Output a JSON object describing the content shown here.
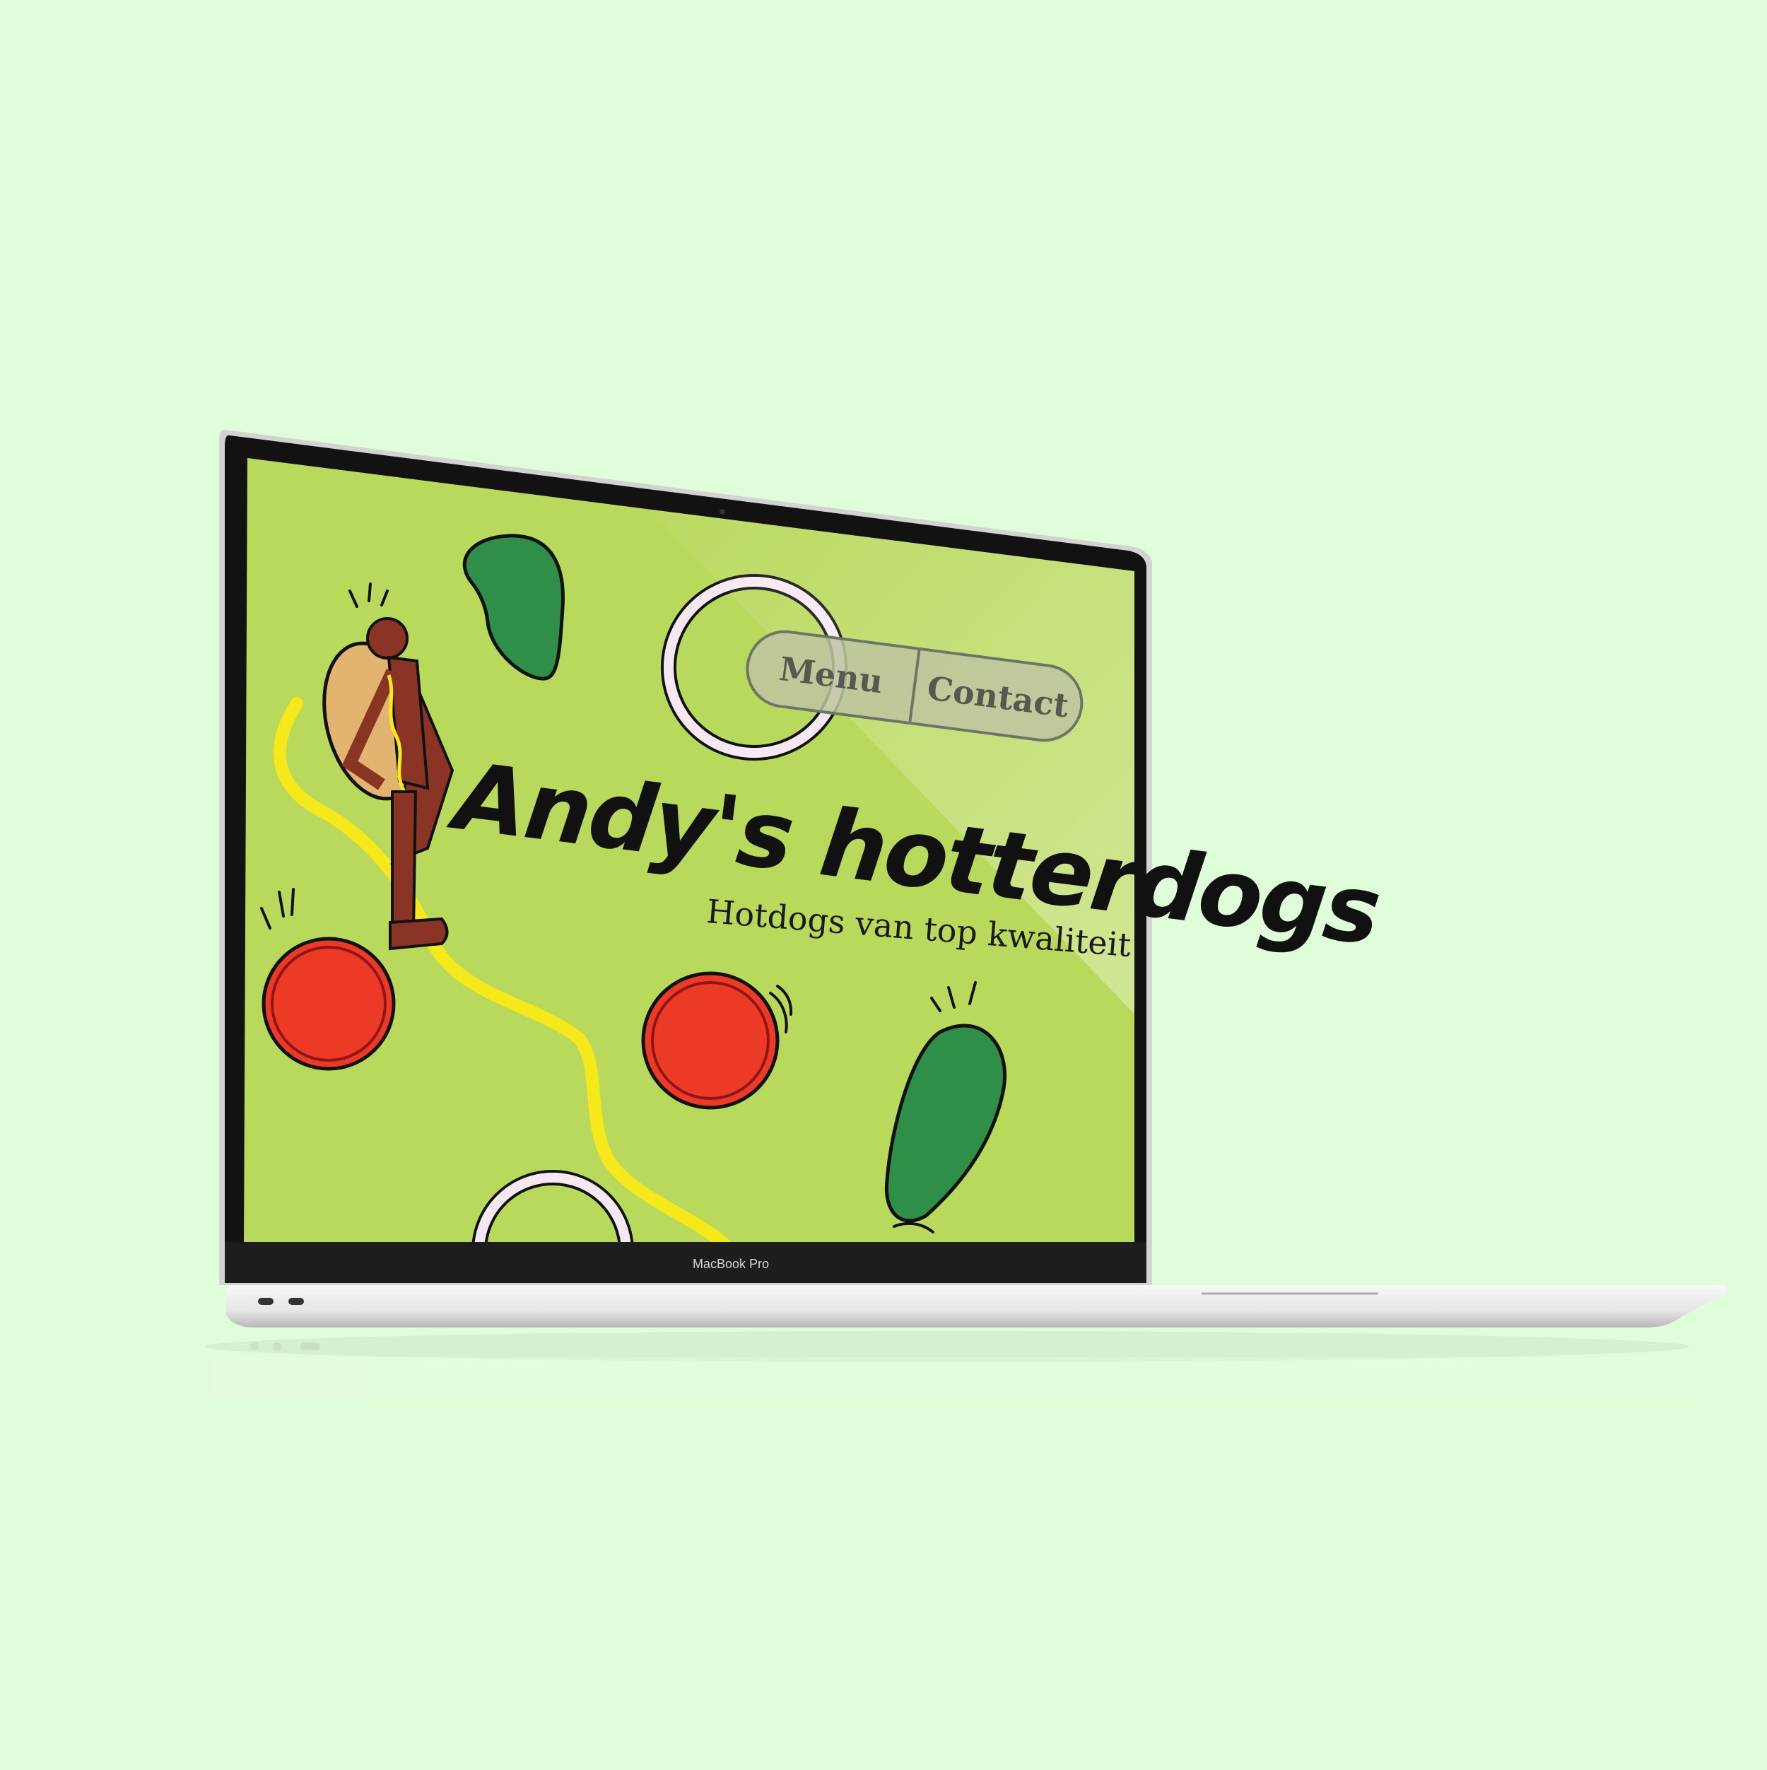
{
  "site": {
    "title": "Andy's hotterdogs",
    "tagline": "Hotdogs van top kwaliteit",
    "nav": [
      "Menu",
      "Contact"
    ],
    "colors": {
      "background": "#b9d95c",
      "pickle": "#2f8f49",
      "tomato": "#ec3a26",
      "mustard": "#f5e81b",
      "sausage": "#8a3425",
      "bun": "#e2b46f",
      "onion_ring": "#f6e8f2"
    },
    "illustrations": [
      "hotdog-man",
      "pickle",
      "tomato-slice",
      "onion-ring",
      "mustard-swirl"
    ]
  },
  "device": {
    "label": "MacBook Pro",
    "ports": [
      "usb-c-port",
      "usb-c-port"
    ]
  },
  "page": {
    "background": "#e0fdda"
  }
}
